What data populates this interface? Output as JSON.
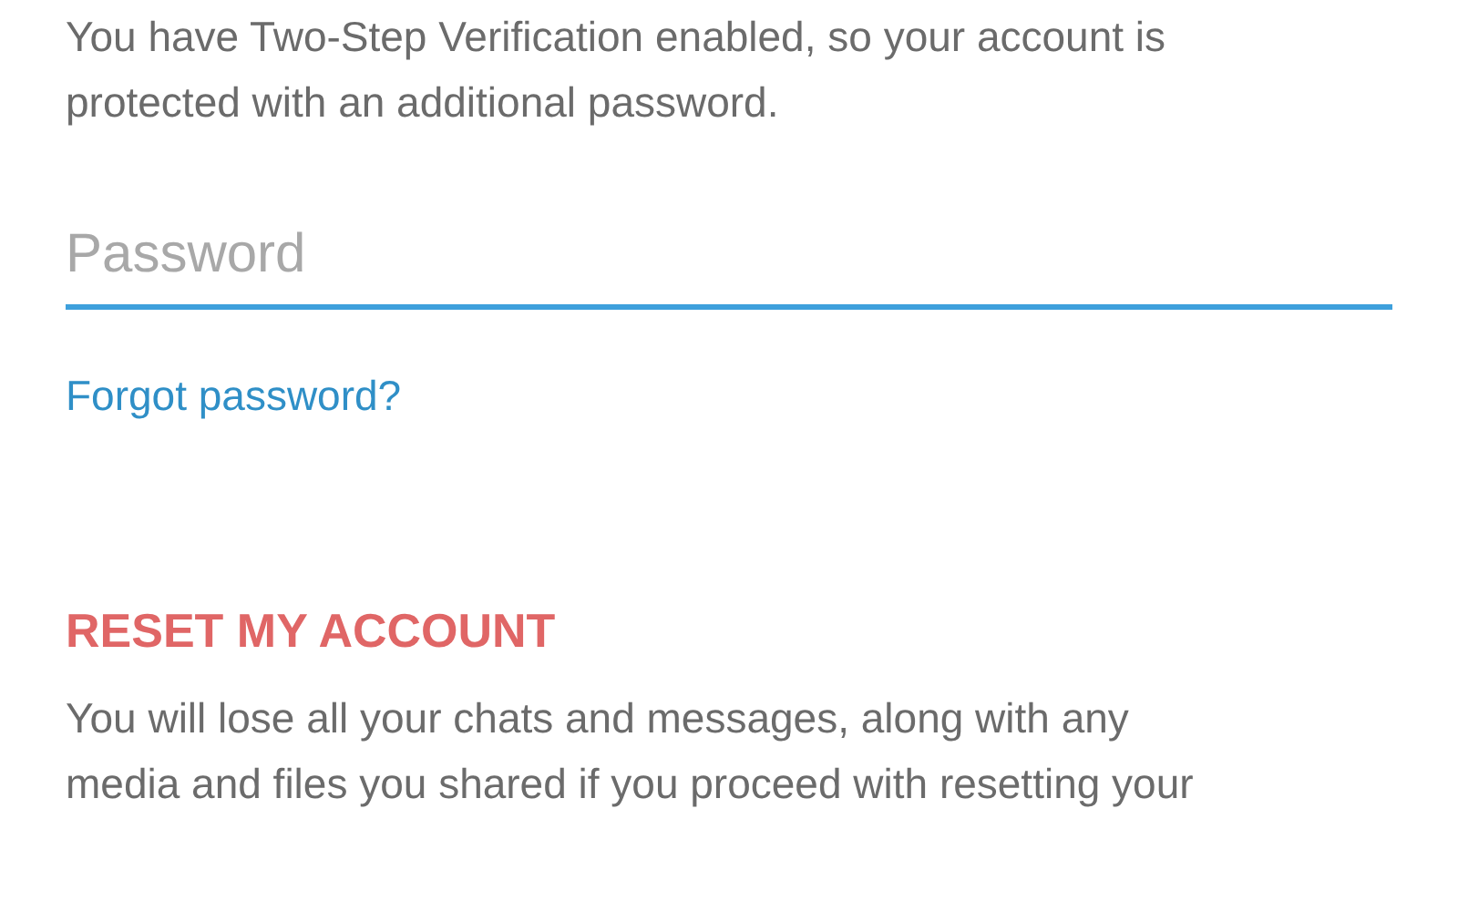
{
  "intro": "You have Two-Step Verification enabled, so your account is protected with an additional password.",
  "password_field": {
    "placeholder": "Password",
    "focused": true
  },
  "forgot_link": "Forgot password?",
  "reset": {
    "title": "RESET MY ACCOUNT",
    "description": "You will lose all your chats and messages, along with any media and files you shared if you proceed with resetting your"
  }
}
